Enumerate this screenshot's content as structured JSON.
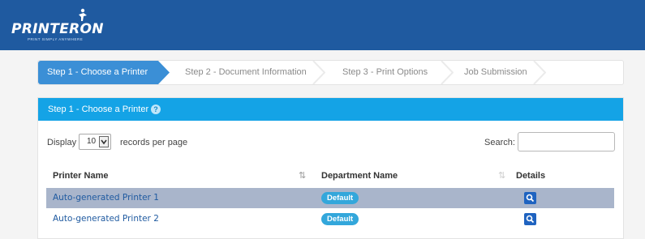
{
  "brand": {
    "logo_text": "PRINTERON",
    "tagline": "PRINT SIMPLY ANYWHERE"
  },
  "steps": [
    {
      "label": "Step 1 - Choose a Printer",
      "active": true
    },
    {
      "label": "Step 2 - Document Information",
      "active": false
    },
    {
      "label": "Step 3 - Print Options",
      "active": false
    },
    {
      "label": "Job Submission",
      "active": false
    }
  ],
  "panel": {
    "title": "Step 1 - Choose a Printer",
    "help_icon": "question-circle-icon"
  },
  "table_controls": {
    "display_label": "Display",
    "page_size": "10",
    "records_label": "records per page",
    "search_label": "Search:",
    "search_value": ""
  },
  "table": {
    "columns": [
      "Printer Name",
      "Department Name",
      "Details"
    ],
    "rows": [
      {
        "printer": "Auto-generated Printer 1",
        "department": "Default",
        "selected": true
      },
      {
        "printer": "Auto-generated Printer 2",
        "department": "Default",
        "selected": false
      }
    ]
  },
  "colors": {
    "header_bg": "#1f5aa0",
    "active_step": "#3b8fd6",
    "panel_head": "#14a3e6",
    "selected_row": "#a9b5cb",
    "badge": "#33a7db",
    "detail_button": "#1f63c0"
  }
}
